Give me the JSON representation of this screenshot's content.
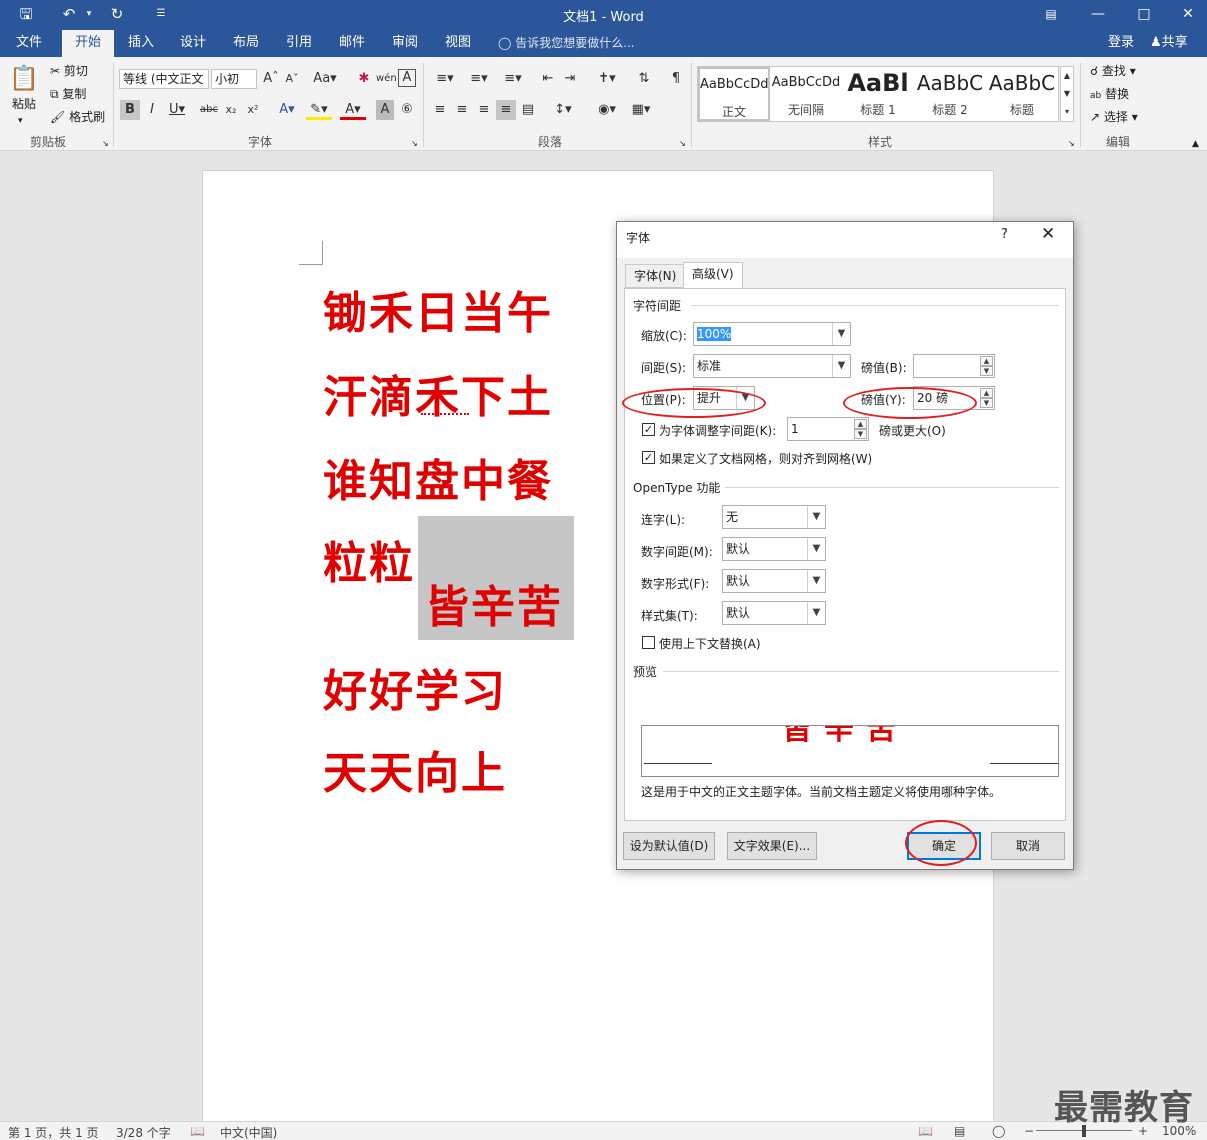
{
  "window": {
    "title": "文档1 - Word",
    "quick_access": [
      "save-icon",
      "undo-icon",
      "redo-icon",
      "customize-icon"
    ]
  },
  "ribbon_tabs": [
    "文件",
    "开始",
    "插入",
    "设计",
    "布局",
    "引用",
    "邮件",
    "审阅",
    "视图"
  ],
  "active_tab": "开始",
  "tell_me": "告诉我您想要做什么...",
  "account": {
    "login": "登录",
    "share": "共享"
  },
  "clipboard": {
    "paste": "粘贴",
    "cut": "剪切",
    "copy": "复制",
    "format_painter": "格式刷",
    "label": "剪贴板"
  },
  "font_group": {
    "font_name": "等线 (中文正文",
    "font_size": "小初",
    "label": "字体"
  },
  "paragraph_group": {
    "label": "段落"
  },
  "styles_group": {
    "label": "样式",
    "items": [
      {
        "preview": "AaBbCcDd",
        "name": "正文"
      },
      {
        "preview": "AaBbCcDd",
        "name": "无间隔"
      },
      {
        "preview": "AaBl",
        "name": "标题 1"
      },
      {
        "preview": "AaBbC",
        "name": "标题 2"
      },
      {
        "preview": "AaBbC",
        "name": "标题"
      }
    ]
  },
  "editing_group": {
    "find": "查找",
    "replace": "替换",
    "select": "选择",
    "label": "编辑"
  },
  "document": {
    "lines": [
      "锄禾日当午",
      "汗滴禾下土",
      "谁知盘中餐",
      "粒粒",
      "好好学习",
      "天天向上"
    ],
    "raised_text": "皆辛苦"
  },
  "dialog": {
    "title": "字体",
    "help": "?",
    "tabs": [
      "字体(N)",
      "高级(V)"
    ],
    "active_tab": "高级(V)",
    "char_spacing": {
      "section": "字符间距",
      "scale_label": "缩放(C):",
      "scale_value": "100%",
      "spacing_label": "间距(S):",
      "spacing_value": "标准",
      "spacing_by_label": "磅值(B):",
      "spacing_by_value": "",
      "position_label": "位置(P):",
      "position_value": "提升",
      "position_by_label": "磅值(Y):",
      "position_by_value": "20 磅",
      "kerning_label": "为字体调整字间距(K):",
      "kerning_checked": true,
      "kerning_value": "1",
      "kerning_suffix": "磅或更大(O)",
      "grid_label": "如果定义了文档网格，则对齐到网格(W)",
      "grid_checked": true
    },
    "opentype": {
      "section": "OpenType 功能",
      "ligatures_label": "连字(L):",
      "ligatures_value": "无",
      "num_spacing_label": "数字间距(M):",
      "num_spacing_value": "默认",
      "num_forms_label": "数字形式(F):",
      "num_forms_value": "默认",
      "style_sets_label": "样式集(T):",
      "style_sets_value": "默认",
      "contextual_label": "使用上下文替换(A)",
      "contextual_checked": false
    },
    "preview": {
      "section": "预览",
      "sample": "皆辛苦",
      "note": "这是用于中文的正文主题字体。当前文档主题定义将使用哪种字体。"
    },
    "buttons": {
      "set_default": "设为默认值(D)",
      "text_effects": "文字效果(E)...",
      "ok": "确定",
      "cancel": "取消"
    }
  },
  "status_bar": {
    "page": "第 1 页，共 1 页",
    "words": "3/28 个字",
    "language": "中文(中国)",
    "zoom": "100%"
  },
  "watermark": "最需教育",
  "colors": {
    "brand": "#2b579a",
    "text_red": "#e00000",
    "annotation": "#e02020"
  }
}
